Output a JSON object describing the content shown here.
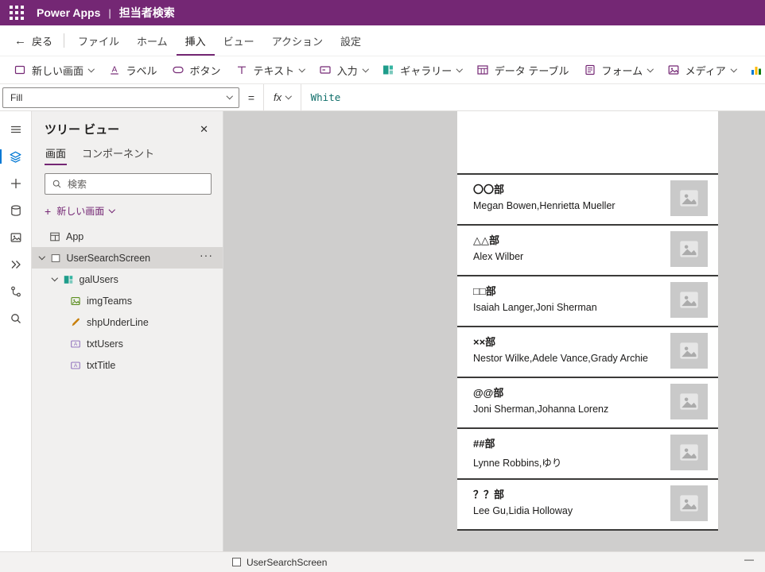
{
  "topbar": {
    "app_name": "Power Apps",
    "separator": "|",
    "doc_title": "担当者検索"
  },
  "menubar": {
    "back_arrow": "←",
    "back_label": "戻る",
    "items": [
      {
        "label": "ファイル",
        "active": false
      },
      {
        "label": "ホーム",
        "active": false
      },
      {
        "label": "挿入",
        "active": true
      },
      {
        "label": "ビュー",
        "active": false
      },
      {
        "label": "アクション",
        "active": false
      },
      {
        "label": "設定",
        "active": false
      }
    ]
  },
  "toolbar": {
    "buttons": [
      {
        "label": "新しい画面",
        "dropdown": true
      },
      {
        "label": "ラベル",
        "dropdown": false
      },
      {
        "label": "ボタン",
        "dropdown": false
      },
      {
        "label": "テキスト",
        "dropdown": true
      },
      {
        "label": "入力",
        "dropdown": true
      },
      {
        "label": "ギャラリー",
        "dropdown": true
      },
      {
        "label": "データ テーブル",
        "dropdown": false
      },
      {
        "label": "フォーム",
        "dropdown": true
      },
      {
        "label": "メディア",
        "dropdown": true
      }
    ]
  },
  "formula_bar": {
    "property": "Fill",
    "equals": "=",
    "fx_label": "fx",
    "formula": "White"
  },
  "left_rail": {
    "icons": [
      "hamburger",
      "tree-view",
      "insert",
      "data",
      "media",
      "power-automate",
      "variables",
      "search"
    ],
    "active_icon": "tree-view"
  },
  "tree_panel": {
    "title": "ツリー ビュー",
    "close_glyph": "✕",
    "tabs": [
      {
        "label": "画面",
        "active": true
      },
      {
        "label": "コンポーネント",
        "active": false
      }
    ],
    "search_placeholder": "検索",
    "plus_glyph": "+",
    "new_screen_label": "新しい画面",
    "more_label": "···",
    "items": [
      {
        "label": "App"
      },
      {
        "label": "UserSearchScreen",
        "selected": true
      },
      {
        "label": "galUsers"
      },
      {
        "label": "imgTeams"
      },
      {
        "label": "shpUnderLine"
      },
      {
        "label": "txtUsers"
      },
      {
        "label": "txtTitle"
      }
    ]
  },
  "canvas": {
    "gallery_rows": [
      {
        "title": "〇〇部",
        "members": "Megan Bowen,Henrietta Mueller"
      },
      {
        "title": "△△部",
        "members": "Alex Wilber"
      },
      {
        "title": "□□部",
        "members": "Isaiah Langer,Joni Sherman"
      },
      {
        "title": "××部",
        "members": "Nestor Wilke,Adele Vance,Grady Archie"
      },
      {
        "title": "@@部",
        "members": "Joni Sherman,Johanna Lorenz"
      },
      {
        "title": "##部",
        "members": "Lynne Robbins,ゆり"
      },
      {
        "title": "？？部",
        "members": "Lee Gu,Lidia Holloway"
      }
    ]
  },
  "status_bar": {
    "screen_label": "UserSearchScreen",
    "minimize_glyph": "—"
  },
  "colors": {
    "brand": "#742774",
    "accent_blue": "#0078d4",
    "formula_teal": "#0f6e6a"
  }
}
